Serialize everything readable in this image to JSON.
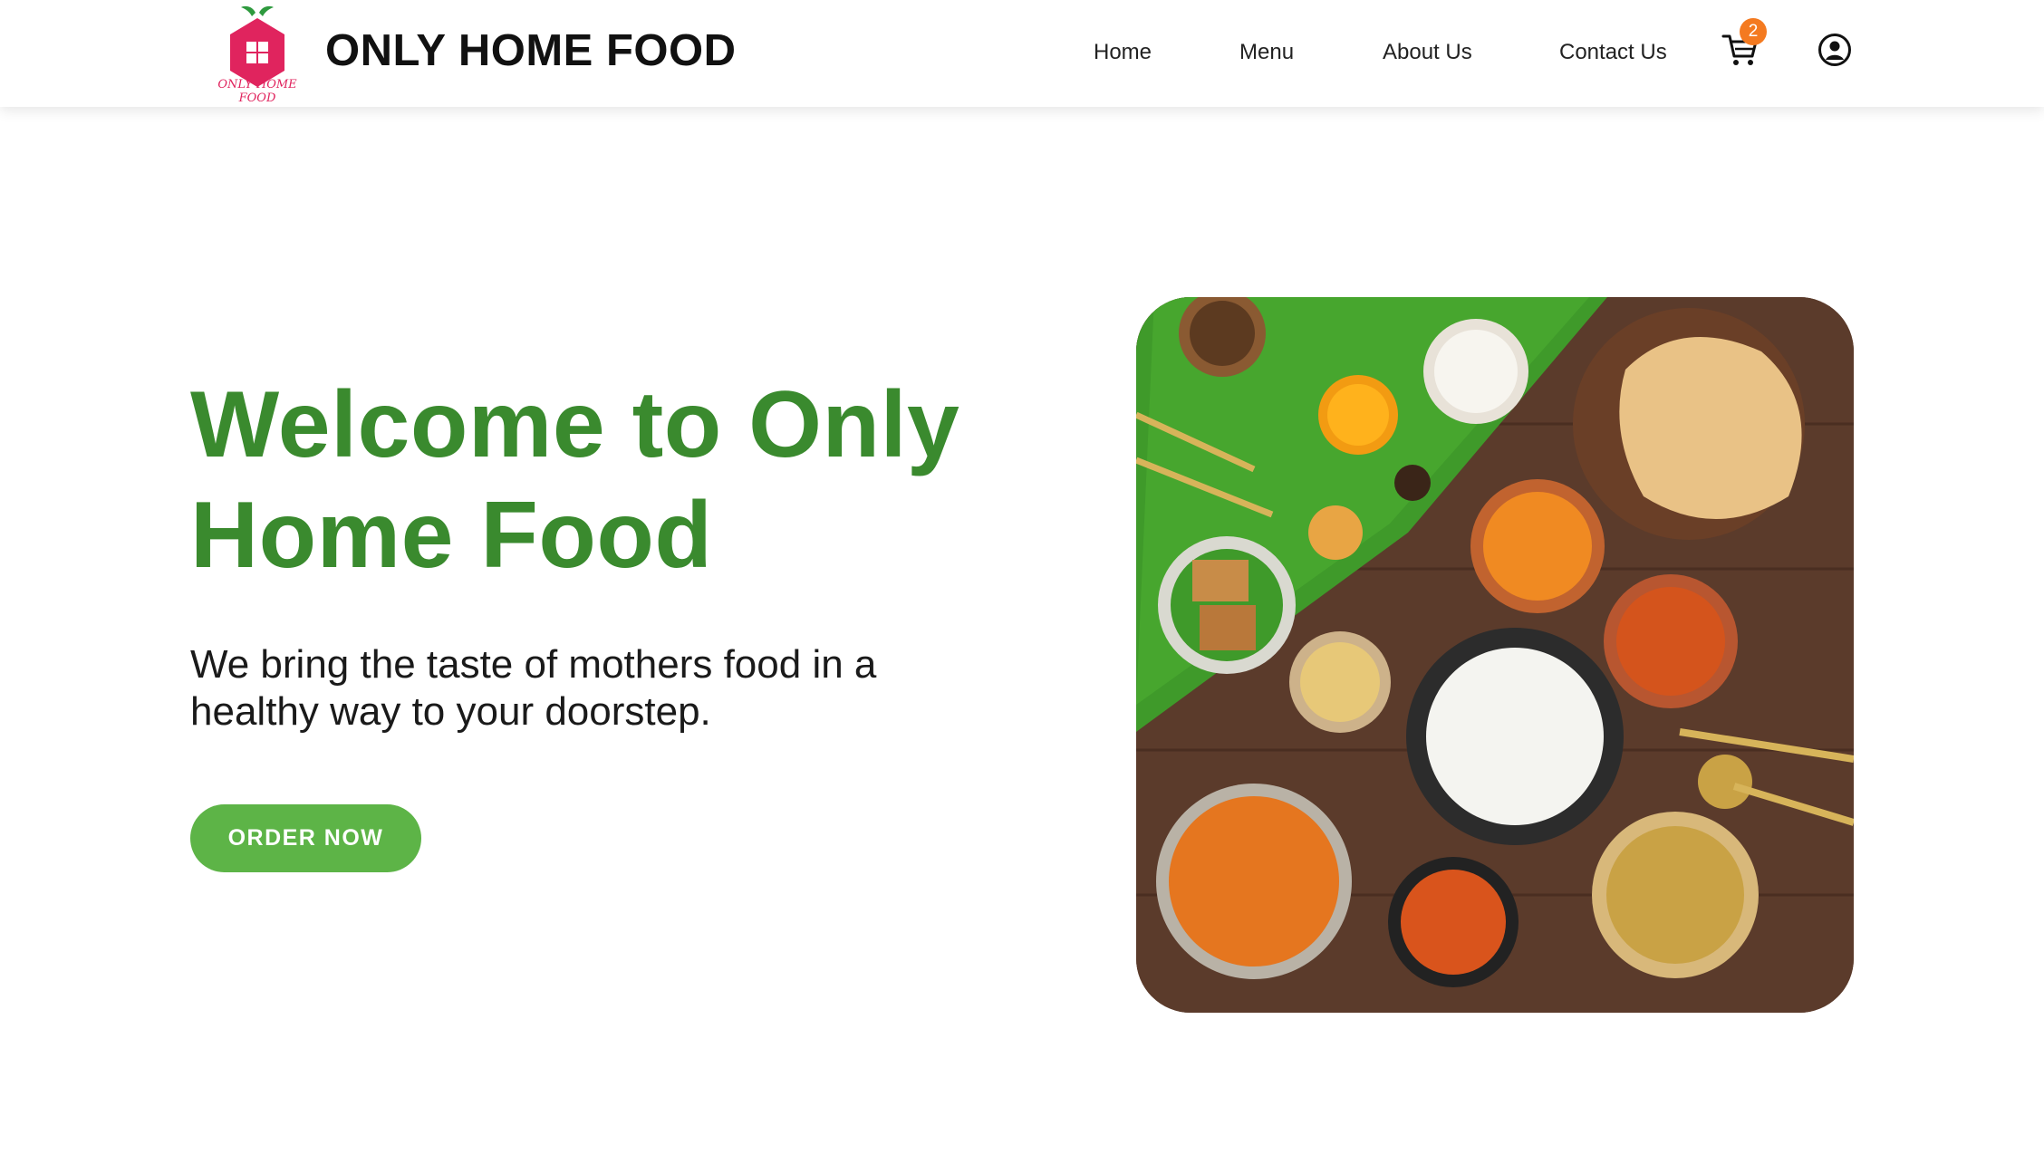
{
  "header": {
    "logo_icon": "house-apple-logo",
    "logo_caption": "ONLY HOME FOOD",
    "brand_name": "ONLY HOME FOOD",
    "nav": [
      {
        "label": "Home"
      },
      {
        "label": "Menu"
      },
      {
        "label": "About Us"
      },
      {
        "label": "Contact Us"
      }
    ],
    "cart_icon": "shopping-cart-icon",
    "cart_count": "2",
    "account_icon": "user-circle-icon"
  },
  "hero": {
    "title": "Welcome to Only Home Food",
    "subtitle": "We bring the taste of mothers food in a healthy way to your doorstep.",
    "cta_label": "ORDER NOW",
    "image_alt": "south-indian-thali-food-photo"
  },
  "colors": {
    "brand_green": "#3a8a2e",
    "button_green": "#5db447",
    "logo_red": "#e0245e",
    "badge_orange": "#f47a20"
  }
}
